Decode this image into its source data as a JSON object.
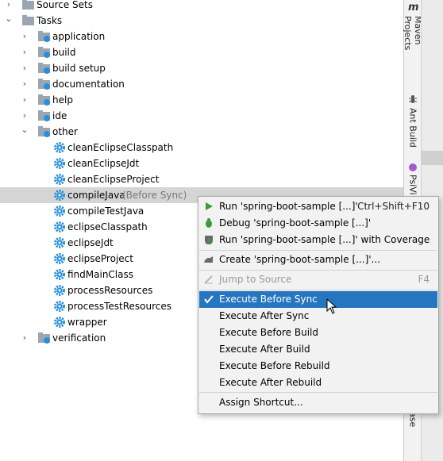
{
  "tree": {
    "rows": [
      {
        "label": "Source Sets",
        "hint": "",
        "kind": "folder",
        "arrow": "›"
      },
      {
        "label": "Tasks",
        "hint": "",
        "kind": "folder",
        "arrow": "⌄"
      },
      {
        "label": "application",
        "hint": "",
        "kind": "taskfolder",
        "arrow": "›"
      },
      {
        "label": "build",
        "hint": "",
        "kind": "taskfolder",
        "arrow": "›"
      },
      {
        "label": "build setup",
        "hint": "",
        "kind": "taskfolder",
        "arrow": "›"
      },
      {
        "label": "documentation",
        "hint": "",
        "kind": "taskfolder",
        "arrow": "›"
      },
      {
        "label": "help",
        "hint": "",
        "kind": "taskfolder",
        "arrow": "›"
      },
      {
        "label": "ide",
        "hint": "",
        "kind": "taskfolder",
        "arrow": "›"
      },
      {
        "label": "other",
        "hint": "",
        "kind": "taskfolder",
        "arrow": "⌄"
      },
      {
        "label": "cleanEclipseClasspath",
        "hint": "",
        "kind": "task",
        "arrow": ""
      },
      {
        "label": "cleanEclipseJdt",
        "hint": "",
        "kind": "task",
        "arrow": ""
      },
      {
        "label": "cleanEclipseProject",
        "hint": "",
        "kind": "task",
        "arrow": ""
      },
      {
        "label": "compileJava",
        "hint": "(Before Sync)",
        "kind": "task",
        "arrow": "",
        "selected": true
      },
      {
        "label": "compileTestJava",
        "hint": "",
        "kind": "task",
        "arrow": ""
      },
      {
        "label": "eclipseClasspath",
        "hint": "",
        "kind": "task",
        "arrow": ""
      },
      {
        "label": "eclipseJdt",
        "hint": "",
        "kind": "task",
        "arrow": ""
      },
      {
        "label": "eclipseProject",
        "hint": "",
        "kind": "task",
        "arrow": ""
      },
      {
        "label": "findMainClass",
        "hint": "",
        "kind": "task",
        "arrow": ""
      },
      {
        "label": "processResources",
        "hint": "",
        "kind": "task",
        "arrow": ""
      },
      {
        "label": "processTestResources",
        "hint": "",
        "kind": "task",
        "arrow": ""
      },
      {
        "label": "wrapper",
        "hint": "",
        "kind": "task",
        "arrow": ""
      },
      {
        "label": "verification",
        "hint": "",
        "kind": "taskfolder",
        "arrow": "›"
      }
    ]
  },
  "sidebar": {
    "maven_label": "Maven Projects",
    "maven_icon": "m",
    "ant_label": "Ant Build",
    "psi_label": "PsiVi",
    "db_label": "base"
  },
  "menu": {
    "items": [
      {
        "label": "Run 'spring-boot-sample [...]'",
        "shortcut": "Ctrl+Shift+F10",
        "icon": "run-icon"
      },
      {
        "label": "Debug 'spring-boot-sample [...]'",
        "shortcut": "",
        "icon": "debug-icon"
      },
      {
        "label": "Run 'spring-boot-sample [...]' with Coverage",
        "shortcut": "",
        "icon": "coverage-icon"
      },
      {
        "label": "Create 'spring-boot-sample [...]'...",
        "shortcut": "",
        "icon": "create-icon"
      },
      {
        "label": "Jump to Source",
        "shortcut": "F4",
        "icon": "jump-icon",
        "disabled": true
      },
      {
        "label": "Execute Before Sync",
        "shortcut": "",
        "icon": "check-icon",
        "active": true
      },
      {
        "label": "Execute After Sync",
        "shortcut": "",
        "icon": ""
      },
      {
        "label": "Execute Before Build",
        "shortcut": "",
        "icon": ""
      },
      {
        "label": "Execute After Build",
        "shortcut": "",
        "icon": ""
      },
      {
        "label": "Execute Before Rebuild",
        "shortcut": "",
        "icon": ""
      },
      {
        "label": "Execute After Rebuild",
        "shortcut": "",
        "icon": ""
      },
      {
        "label": "Assign Shortcut...",
        "shortcut": "",
        "icon": ""
      }
    ]
  },
  "colors": {
    "selection": "#2675bf",
    "row_selected": "#d5d5d5",
    "gear": "#2b8fd8",
    "run_green": "#3a9b3a"
  }
}
